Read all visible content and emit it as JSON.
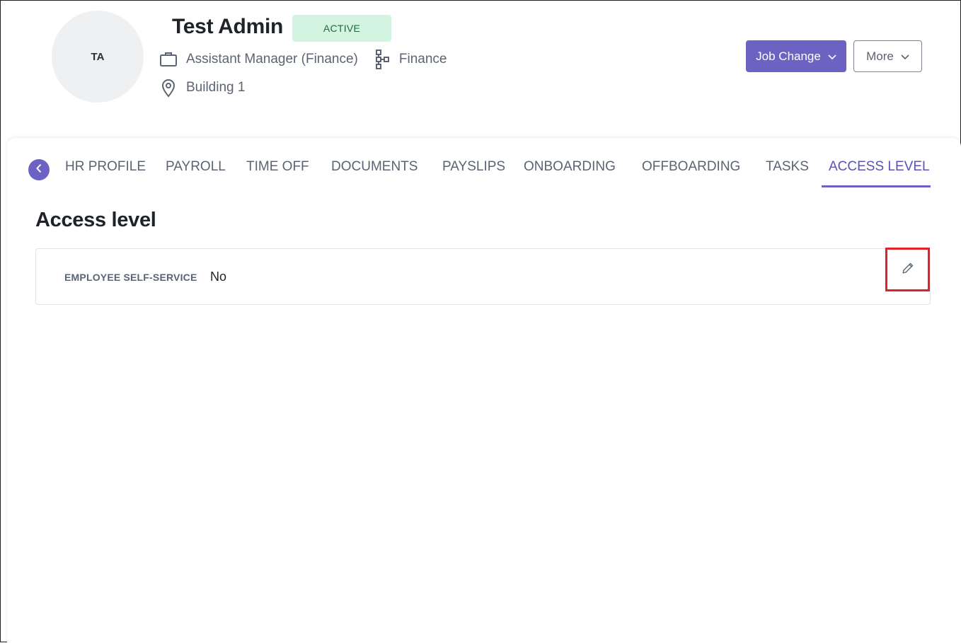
{
  "profile": {
    "initials": "TA",
    "name": "Test Admin",
    "status": "ACTIVE",
    "job_title": "Assistant Manager (Finance)",
    "department": "Finance",
    "location": "Building 1"
  },
  "actions": {
    "job_change_label": "Job Change",
    "more_label": "More"
  },
  "tabs": [
    {
      "label": "HR PROFILE",
      "active": false
    },
    {
      "label": "PAYROLL",
      "active": false
    },
    {
      "label": "TIME OFF",
      "active": false
    },
    {
      "label": "DOCUMENTS",
      "active": false
    },
    {
      "label": "PAYSLIPS",
      "active": false
    },
    {
      "label": "ONBOARDING",
      "active": false
    },
    {
      "label": "OFFBOARDING",
      "active": false
    },
    {
      "label": "TASKS",
      "active": false
    },
    {
      "label": "ACCESS LEVEL",
      "active": true
    }
  ],
  "section": {
    "title": "Access level",
    "fields": [
      {
        "label": "EMPLOYEE SELF-SERVICE",
        "value": "No"
      }
    ]
  },
  "colors": {
    "accent": "#6b62c4",
    "status_bg": "#d4f4e2",
    "highlight": "#e0202a"
  },
  "icons": {
    "back": "chevron-left-icon",
    "job": "briefcase-icon",
    "department": "org-chart-icon",
    "location": "map-pin-icon",
    "edit": "pencil-icon",
    "dropdown": "chevron-down-icon"
  }
}
